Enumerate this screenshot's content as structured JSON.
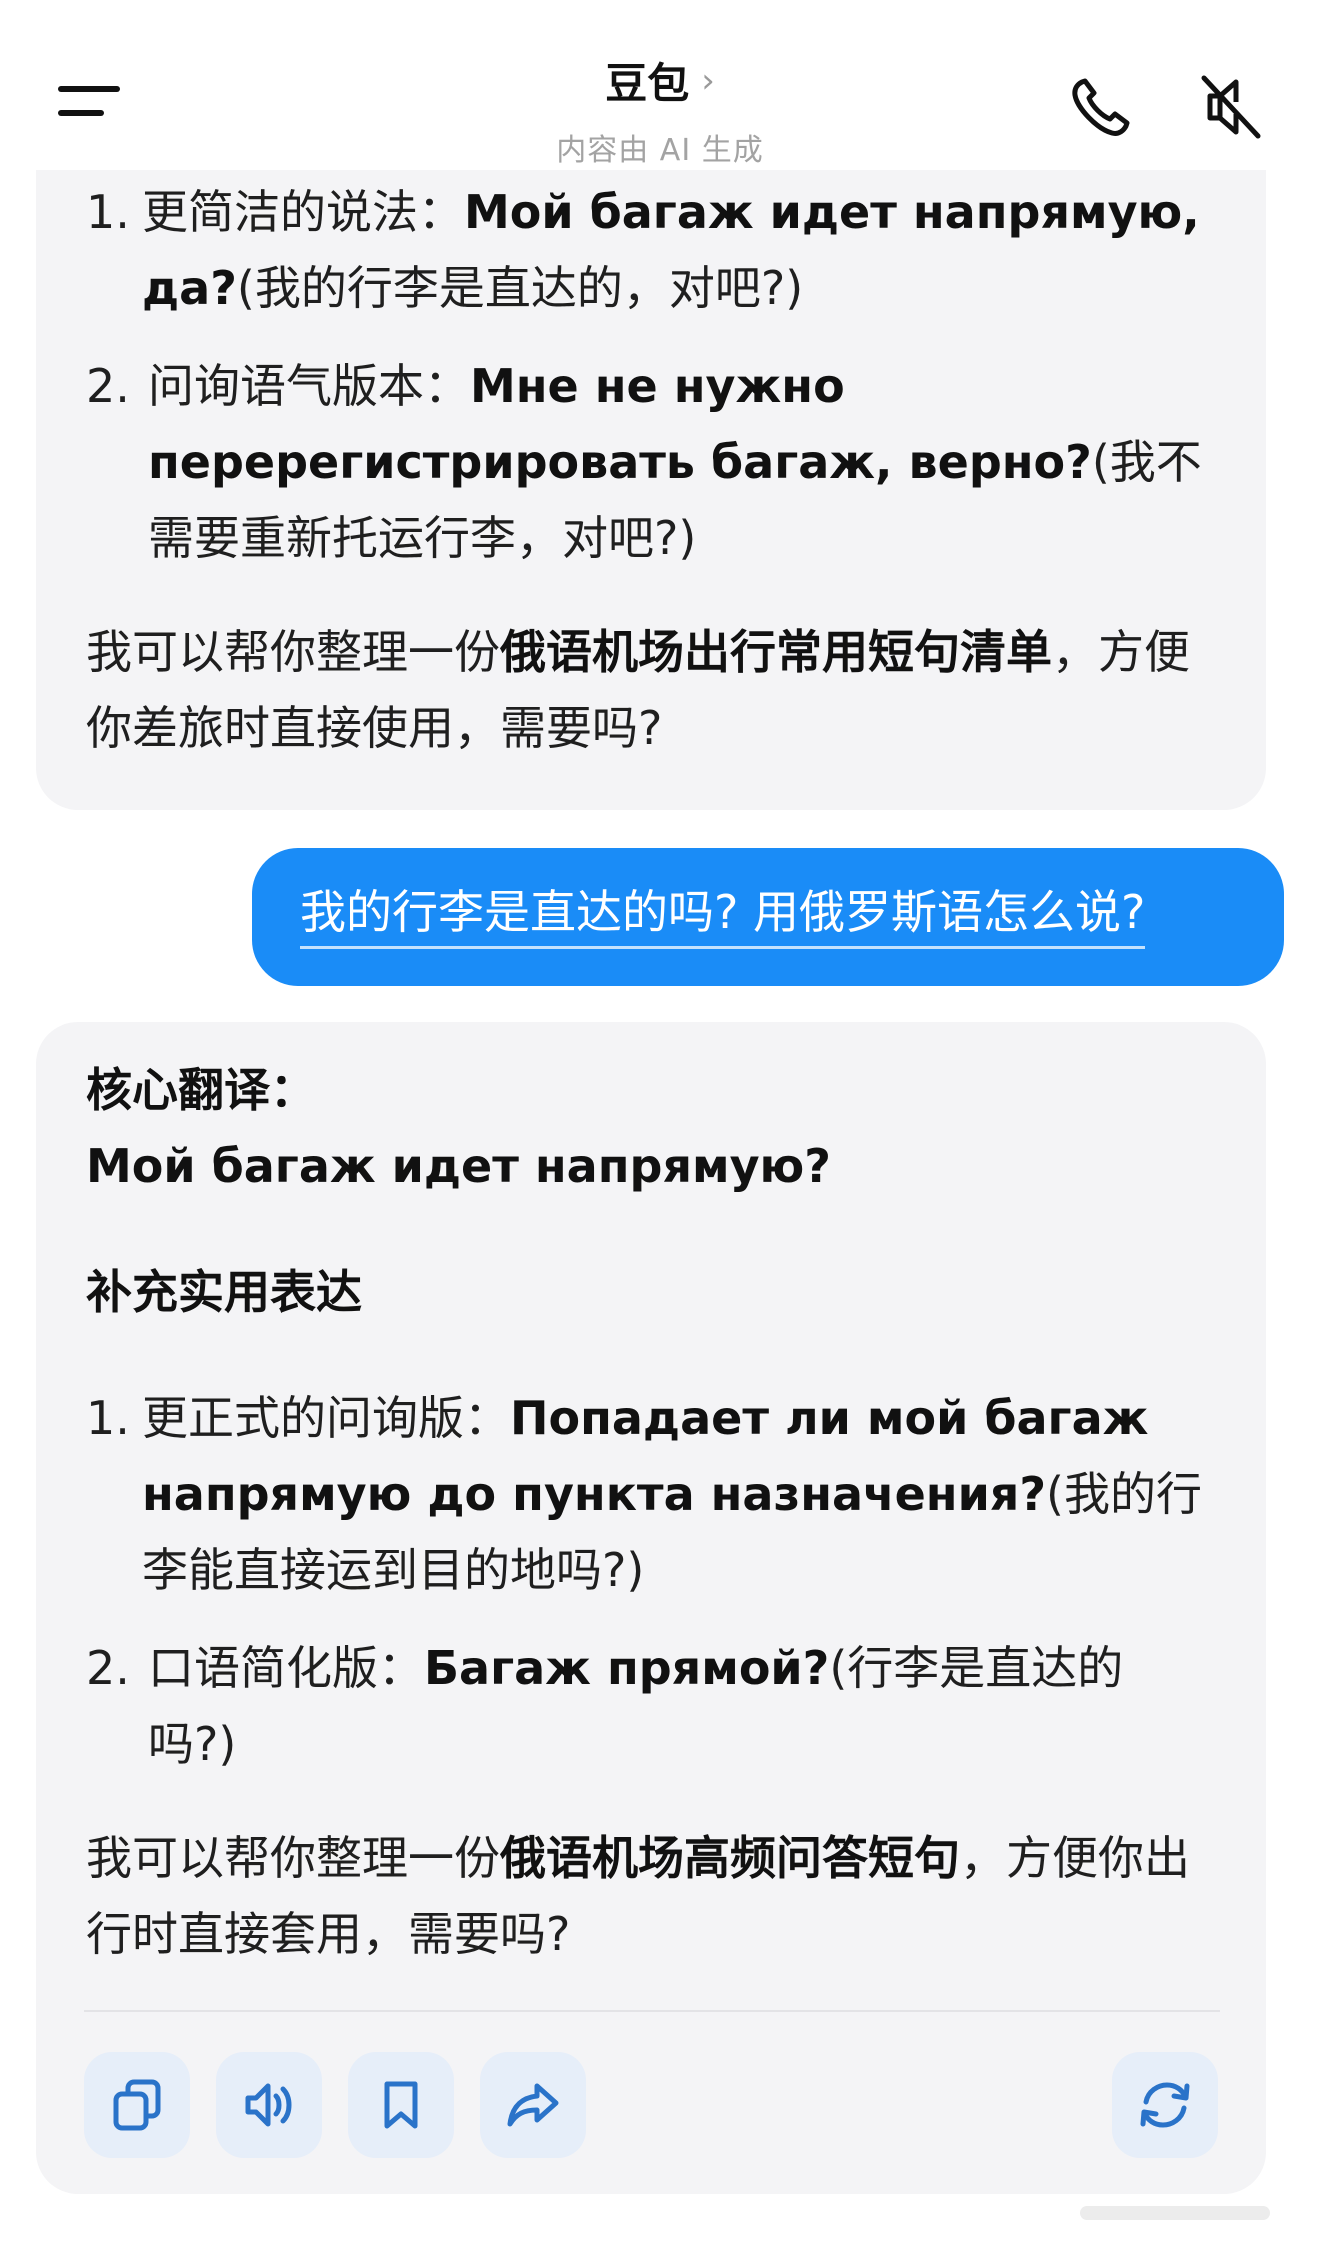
{
  "header": {
    "title": "豆包",
    "title_chevron": "›",
    "subtitle": "内容由 AI 生成",
    "icons": [
      "menu-icon",
      "phone-icon",
      "mute-icon"
    ]
  },
  "ai_message_1": {
    "items": [
      {
        "num": "1.",
        "label": "更简洁的说法：",
        "phrase": "Мой багаж идет напрямую, да?",
        "gloss": "(我的行李是直达的，对吧?)"
      },
      {
        "num": "2.",
        "label": "问询语气版本：",
        "phrase": "Мне не нужно перерегистрировать багаж, верно?",
        "gloss": "(我不需要重新托运行李，对吧?)"
      }
    ],
    "closing": {
      "before": "我可以帮你整理一份",
      "bold": "俄语机场出行常用短句清单",
      "after": "，方便你差旅时直接使用，需要吗?"
    }
  },
  "user_message": {
    "text": "我的行李是直达的吗? 用俄罗斯语怎么说?"
  },
  "ai_message_2": {
    "core_heading": "核心翻译：",
    "core_phrase": "Мой багаж идет напрямую?",
    "supplement_heading": "补充实用表达",
    "items": [
      {
        "num": "1.",
        "label": "更正式的问询版：",
        "phrase": "Попадает ли мой багаж напрямую до пункта назначения?",
        "gloss": "(我的行李能直接运到目的地吗?)"
      },
      {
        "num": "2.",
        "label": "口语简化版：",
        "phrase": "Багаж прямой?",
        "gloss": "(行李是直达的吗?)"
      }
    ],
    "closing": {
      "before": "我可以帮你整理一份",
      "bold": "俄语机场高频问答短句",
      "after": "，方便你出行时直接套用，需要吗?"
    }
  },
  "actions": [
    "copy-icon",
    "speaker-icon",
    "bookmark-icon",
    "share-icon",
    "regenerate-icon"
  ],
  "colors": {
    "user_bubble": "#1a8cf7",
    "ai_bubble": "#f4f4f6",
    "action_bg": "#e6eef9",
    "action_icon": "#2a73c9"
  }
}
